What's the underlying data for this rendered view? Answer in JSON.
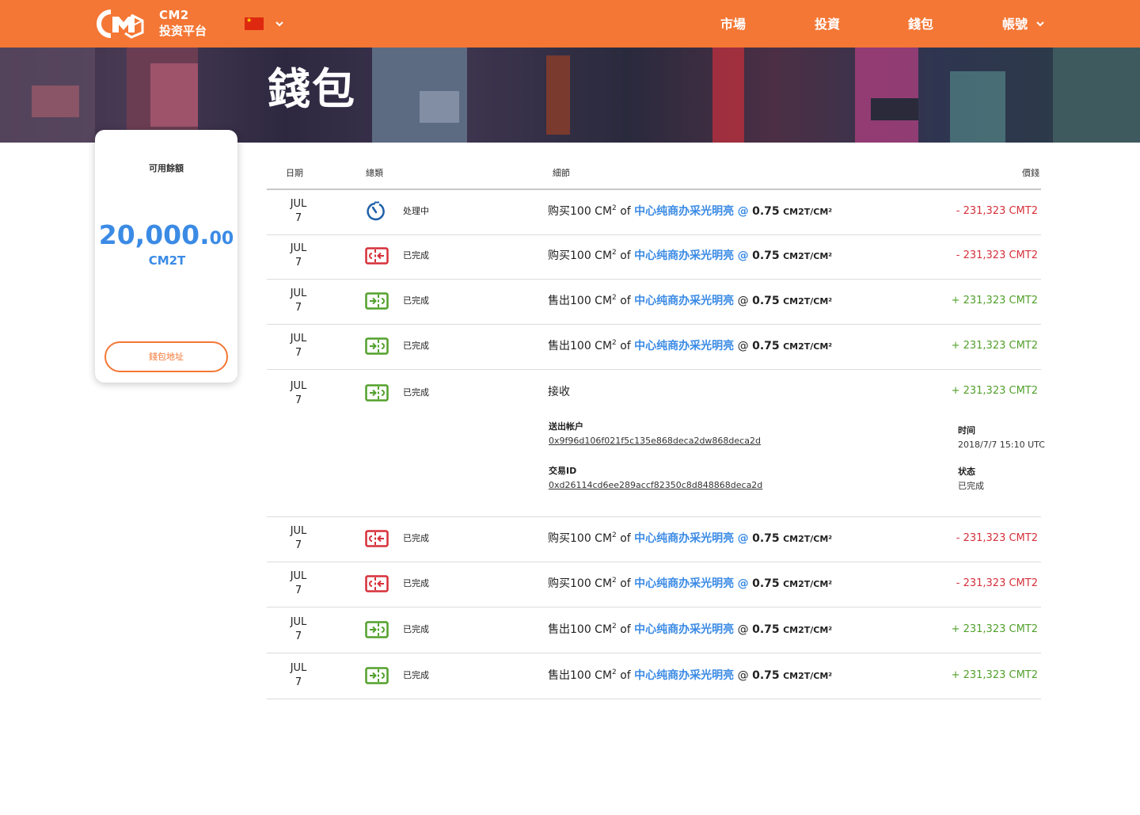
{
  "nav": {
    "brand_line1": "CM2",
    "brand_line2": "投资平台",
    "items": [
      "市場",
      "投資",
      "錢包",
      "帳號"
    ]
  },
  "hero": {
    "title": "錢包"
  },
  "balance": {
    "label": "可用餘額",
    "amount_main": "20,000.",
    "amount_decimal": "00",
    "unit": "CM2T",
    "address_button": "錢包地址"
  },
  "table": {
    "headers": {
      "date": "日期",
      "type": "總類",
      "detail": "細節",
      "price": "價錢"
    },
    "rows": [
      {
        "month": "JUL",
        "day": "7",
        "icon": "timer-icon",
        "status": "处理中",
        "action": "购买100 CM",
        "project": "中心纯商办采光明亮",
        "at": "@",
        "at_highlight": true,
        "price": "0.75",
        "unit": "CM2T/CM²",
        "amount": "- 231,323 CMT2",
        "sign": "neg"
      },
      {
        "month": "JUL",
        "day": "7",
        "icon": "ticket-out-icon",
        "status": "已完成",
        "action": "购买100 CM",
        "project": "中心纯商办采光明亮",
        "at": "@",
        "at_highlight": true,
        "price": "0.75",
        "unit": "CM2T/CM²",
        "amount": "- 231,323 CMT2",
        "sign": "neg"
      },
      {
        "month": "JUL",
        "day": "7",
        "icon": "ticket-in-icon",
        "status": "已完成",
        "action": "售出100 CM",
        "project": "中心纯商办采光明亮",
        "at": "@",
        "at_highlight": false,
        "price": "0.75",
        "unit": "CM2T/CM²",
        "amount": "+ 231,323 CMT2",
        "sign": "pos"
      },
      {
        "month": "JUL",
        "day": "7",
        "icon": "ticket-in-icon",
        "status": "已完成",
        "action": "售出100 CM",
        "project": "中心纯商办采光明亮",
        "at": "@",
        "at_highlight": false,
        "price": "0.75",
        "unit": "CM2T/CM²",
        "amount": "+ 231,323 CMT2",
        "sign": "pos"
      }
    ],
    "receive_row": {
      "month": "JUL",
      "day": "7",
      "icon": "ticket-in-icon",
      "status": "已完成",
      "title": "接收",
      "amount": "+ 231,323 CMT2",
      "from_label": "送出帐户",
      "from_value": "0x9f96d106f021f5c135e868deca2dw868deca2d",
      "txid_label": "交易ID",
      "txid_value": "0xd26114cd6ee289accf82350c8d848868deca2d",
      "time_label": "时间",
      "time_value": "2018/7/7 15:10 UTC",
      "state_label": "状态",
      "state_value": "已完成"
    },
    "rows_after": [
      {
        "month": "JUL",
        "day": "7",
        "icon": "ticket-out-icon",
        "status": "已完成",
        "action": "购买100 CM",
        "project": "中心纯商办采光明亮",
        "at": "@",
        "at_highlight": true,
        "price": "0.75",
        "unit": "CM2T/CM²",
        "amount": "- 231,323 CMT2",
        "sign": "neg"
      },
      {
        "month": "JUL",
        "day": "7",
        "icon": "ticket-out-icon",
        "status": "已完成",
        "action": "购买100 CM",
        "project": "中心纯商办采光明亮",
        "at": "@",
        "at_highlight": true,
        "price": "0.75",
        "unit": "CM2T/CM²",
        "amount": "- 231,323 CMT2",
        "sign": "neg"
      },
      {
        "month": "JUL",
        "day": "7",
        "icon": "ticket-in-icon",
        "status": "已完成",
        "action": "售出100 CM",
        "project": "中心纯商办采光明亮",
        "at": "@",
        "at_highlight": false,
        "price": "0.75",
        "unit": "CM2T/CM²",
        "amount": "+ 231,323 CMT2",
        "sign": "pos"
      },
      {
        "month": "JUL",
        "day": "7",
        "icon": "ticket-in-icon",
        "status": "已完成",
        "action": "售出100 CM",
        "project": "中心纯商办采光明亮",
        "at": "@",
        "at_highlight": false,
        "price": "0.75",
        "unit": "CM2T/CM²",
        "amount": "+ 231,323 CMT2",
        "sign": "pos"
      }
    ]
  },
  "colors": {
    "accent": "#f47735",
    "link": "#3b8be5",
    "negative": "#d6303a",
    "positive": "#52a02c",
    "timer": "#1f5fa8"
  }
}
